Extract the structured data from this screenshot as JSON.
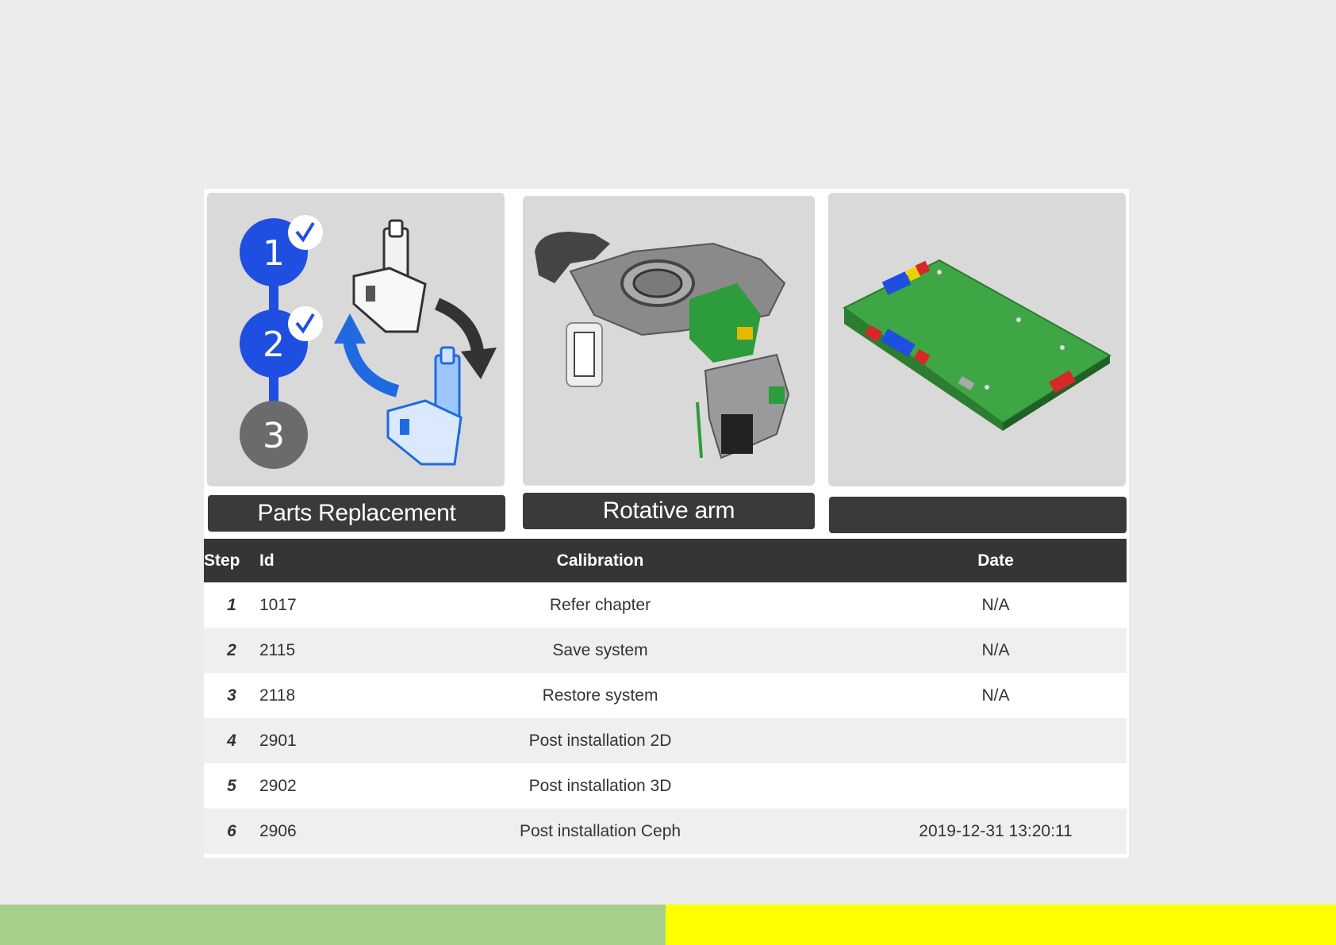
{
  "cards": [
    {
      "label": "Parts Replacement",
      "icon": "parts-replacement-icon",
      "steps": [
        "1",
        "2",
        "3"
      ]
    },
    {
      "label": "Rotative arm",
      "icon": "rotative-arm-icon"
    },
    {
      "label": "",
      "icon": "circuit-board-icon"
    }
  ],
  "table": {
    "headers": {
      "step": "Step",
      "id": "Id",
      "calibration": "Calibration",
      "date": "Date"
    },
    "rows": [
      {
        "step": "1",
        "id": "1017",
        "calibration": "Refer chapter",
        "date": "N/A"
      },
      {
        "step": "2",
        "id": "2115",
        "calibration": "Save system",
        "date": "N/A"
      },
      {
        "step": "3",
        "id": "2118",
        "calibration": "Restore system",
        "date": "N/A"
      },
      {
        "step": "4",
        "id": "2901",
        "calibration": "Post installation 2D",
        "date": ""
      },
      {
        "step": "5",
        "id": "2902",
        "calibration": "Post installation 3D",
        "date": ""
      },
      {
        "step": "6",
        "id": "2906",
        "calibration": "Post installation Ceph",
        "date": "2019-12-31 13:20:11"
      }
    ]
  },
  "colors": {
    "step_blue": "#1f4fe0",
    "step_gray": "#6b6b6b",
    "link_orange": "#e07e3c",
    "bar_green": "#a8d08d",
    "bar_yellow": "#ffff00"
  }
}
